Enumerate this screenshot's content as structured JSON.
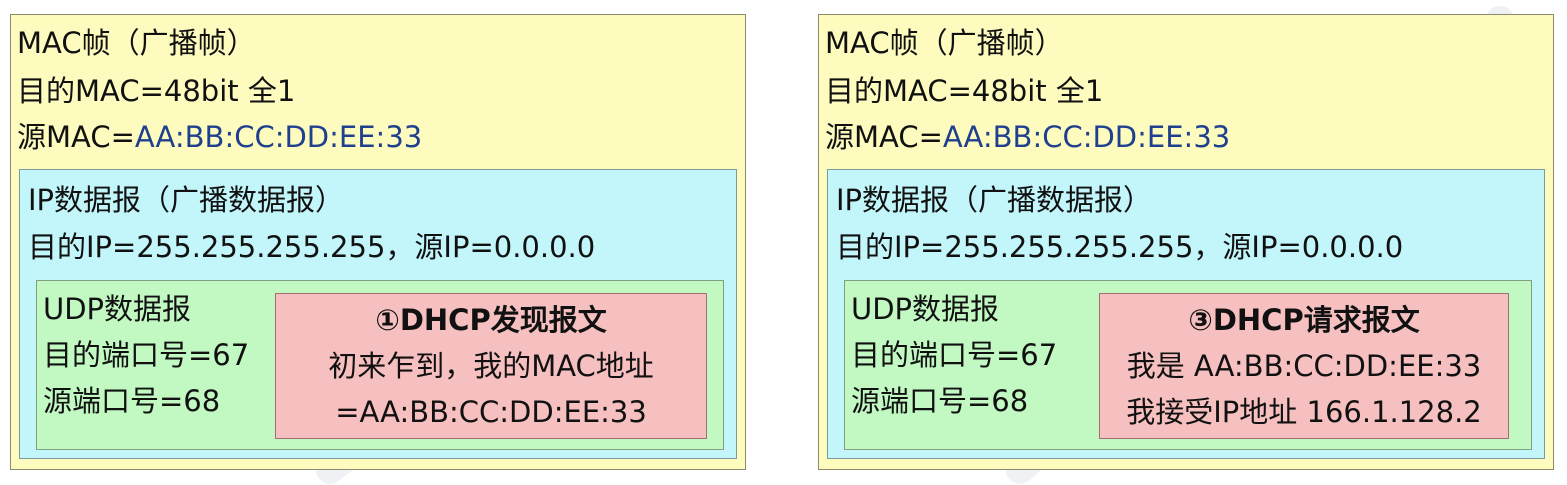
{
  "panels": [
    {
      "mac_title": "MAC帧（广播帧）",
      "mac_dst": "目的MAC=48bit 全1",
      "mac_src_label": "源MAC=",
      "mac_src_value": "AA:BB:CC:DD:EE:33",
      "ip_title": "IP数据报（广播数据报）",
      "ip_addrs": "目的IP=255.255.255.255，源IP=0.0.0.0",
      "udp_title": "UDP数据报",
      "udp_dst": "目的端口号=67",
      "udp_src": "源端口号=68",
      "dhcp_title": "①DHCP发现报文",
      "dhcp_line1": "初来乍到，我的MAC地址",
      "dhcp_line2": "=AA:BB:CC:DD:EE:33"
    },
    {
      "mac_title": "MAC帧（广播帧）",
      "mac_dst": "目的MAC=48bit 全1",
      "mac_src_label": "源MAC=",
      "mac_src_value": "AA:BB:CC:DD:EE:33",
      "ip_title": "IP数据报（广播数据报）",
      "ip_addrs": "目的IP=255.255.255.255，源IP=0.0.0.0",
      "udp_title": "UDP数据报",
      "udp_dst": "目的端口号=67",
      "udp_src": "源端口号=68",
      "dhcp_title": "③DHCP请求报文",
      "dhcp_line1": "我是 AA:BB:CC:DD:EE:33",
      "dhcp_line2": "我接受IP地址 166.1.128.2"
    }
  ]
}
